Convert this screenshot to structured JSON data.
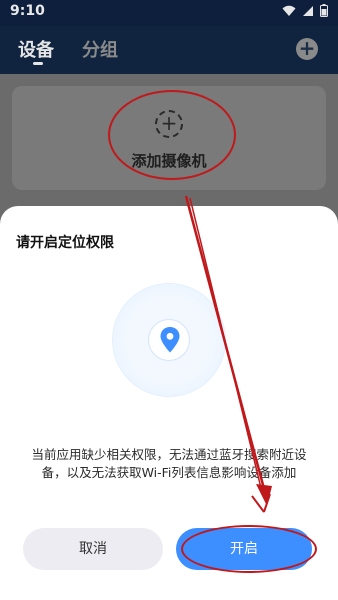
{
  "status": {
    "time": "9:10"
  },
  "header": {
    "tabs": [
      {
        "label": "设备"
      },
      {
        "label": "分组"
      }
    ],
    "add_icon": "plus-circle-icon"
  },
  "main": {
    "add_camera_label": "添加摄像机",
    "add_icon": "dashed-plus-icon"
  },
  "dialog": {
    "title": "请开启定位权限",
    "illustration_icon": "location-pin-icon",
    "message": "当前应用缺少相关权限，无法通过蓝牙搜索附近设备，以及无法获取Wi-Fi列表信息影响设备添加",
    "cancel_label": "取消",
    "confirm_label": "开启"
  },
  "colors": {
    "accent": "#3d8eff",
    "header_bg": "#10233f",
    "annotation": "#c0191c"
  }
}
